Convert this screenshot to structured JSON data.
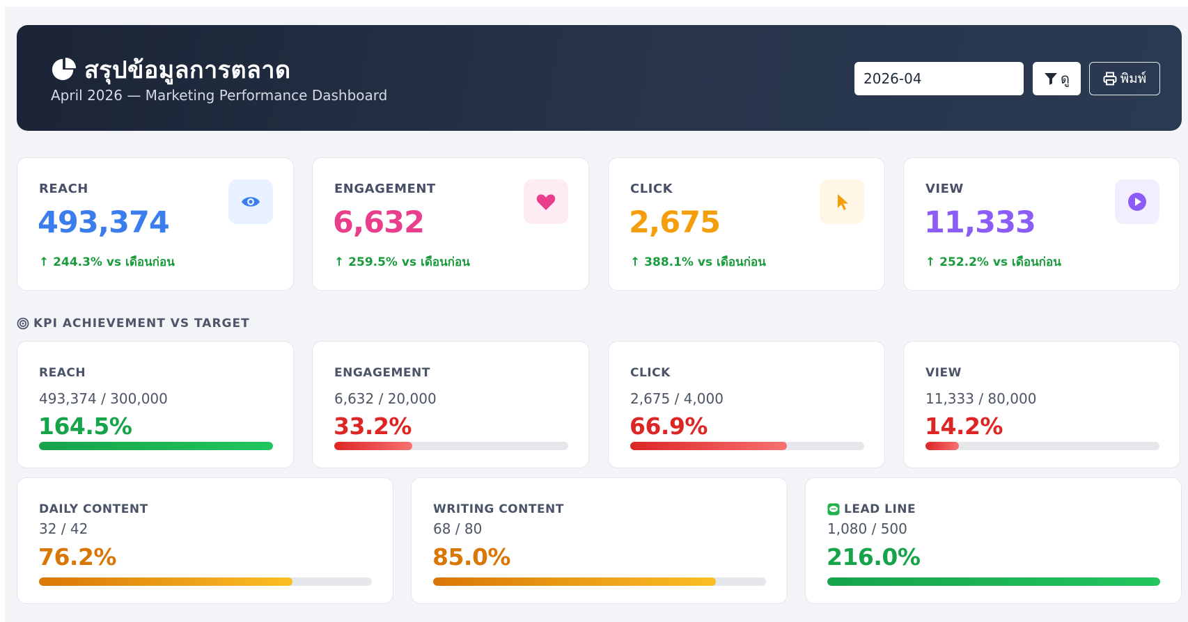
{
  "header": {
    "title": "สรุปข้อมูลการตลาด",
    "subtitle": "April 2026 — Marketing Performance Dashboard",
    "month_value": "2026-04",
    "filter_label": "ดู",
    "print_label": "พิมพ์"
  },
  "stats": [
    {
      "label": "REACH",
      "value": "493,374",
      "change": "↑ 244.3% vs เดือนก่อน",
      "icon": "eye-icon",
      "color": "#3b7ded",
      "icon_bg": "#e8f1ff"
    },
    {
      "label": "ENGAGEMENT",
      "value": "6,632",
      "change": "↑ 259.5% vs เดือนก่อน",
      "icon": "heart-icon",
      "color": "#e83e8c",
      "icon_bg": "#fdecf3"
    },
    {
      "label": "CLICK",
      "value": "2,675",
      "change": "↑ 388.1% vs เดือนก่อน",
      "icon": "pointer-icon",
      "color": "#f59e0b",
      "icon_bg": "#fff6e6"
    },
    {
      "label": "VIEW",
      "value": "11,333",
      "change": "↑ 252.2% vs เดือนก่อน",
      "icon": "play-icon",
      "color": "#8b5cf6",
      "icon_bg": "#f3eefe"
    }
  ],
  "kpi_section_title": "KPI ACHIEVEMENT VS TARGET",
  "kpis": [
    {
      "label": "REACH",
      "ratio": "493,374 / 300,000",
      "percent": "164.5%",
      "progress": 1.0,
      "status": "green"
    },
    {
      "label": "ENGAGEMENT",
      "ratio": "6,632 / 20,000",
      "percent": "33.2%",
      "progress": 0.332,
      "status": "red"
    },
    {
      "label": "CLICK",
      "ratio": "2,675 / 4,000",
      "percent": "66.9%",
      "progress": 0.669,
      "status": "red"
    },
    {
      "label": "VIEW",
      "ratio": "11,333 / 80,000",
      "percent": "14.2%",
      "progress": 0.142,
      "status": "red"
    }
  ],
  "kpis2": [
    {
      "label": "DAILY CONTENT",
      "ratio": "32 / 42",
      "percent": "76.2%",
      "progress": 0.762,
      "status": "orange"
    },
    {
      "label": "WRITING CONTENT",
      "ratio": "68 / 80",
      "percent": "85.0%",
      "progress": 0.85,
      "status": "orange"
    },
    {
      "label": "LEAD LINE",
      "ratio": "1,080 / 500",
      "percent": "216.0%",
      "progress": 1.0,
      "status": "green",
      "icon": "line-chat-icon"
    }
  ],
  "colors": {
    "green": "#16a34a",
    "red": "#dc2626",
    "orange": "#d97706",
    "line_green": "#22b14c"
  }
}
